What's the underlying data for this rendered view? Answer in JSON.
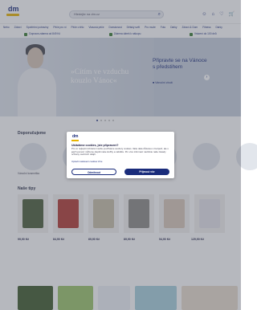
{
  "header": {
    "logo": "dm",
    "search_placeholder": "Hledejte na dm.cz"
  },
  "nav": {
    "items": [
      "Nebo",
      "Zdraví",
      "Spotřební potraviny",
      "Péče pro ni",
      "Péče o tělo",
      "Vlasová péče",
      "Domácnost",
      "Dětský svět",
      "Pro muže",
      "Foto",
      "Dárky",
      "Zdraví & Dom",
      "Fitness",
      "Dárky"
    ]
  },
  "promos": {
    "items": [
      "Doprava zdarma od 849 Kč",
      "Zdarma dárek k nákupu",
      "Vrácení do 100 dnů"
    ]
  },
  "hero": {
    "slogan": "»Cítím ve vzduchu kouzlo Vánoc«",
    "panel_title": "Připravte se na Vánoce s předstihem",
    "panel_sub": "■ Vánoční zboží"
  },
  "sections": {
    "discover": "Doporučujeme",
    "tips": "Naše tipy"
  },
  "categories": {
    "first_label": "Vánoční kosmetika"
  },
  "products": {
    "prices": [
      "99,90 Kč",
      "84,90 Kč",
      "69,90 Kč",
      "89,90 Kč",
      "54,90 Kč",
      "129,90 Kč"
    ]
  },
  "modal": {
    "logo": "dm",
    "title": "Ukládáme cookies, jste připraveni?",
    "body": "Pro co nejlepší zobrazení webu používáme soubory cookies. Vaše data zůstanou v bezpečí, ale s jejich pomocí můžeme zlepšit naše služby a nabídku. Pro více informací navštivte naše zásady ochrany osobních údajů.",
    "links": "Upravit nastavení cookies     Více",
    "reject": "Odmítnout",
    "accept": "Přijmout vše"
  },
  "colors": {
    "brand": "#1a2c7b",
    "accent": "#e8b400"
  }
}
